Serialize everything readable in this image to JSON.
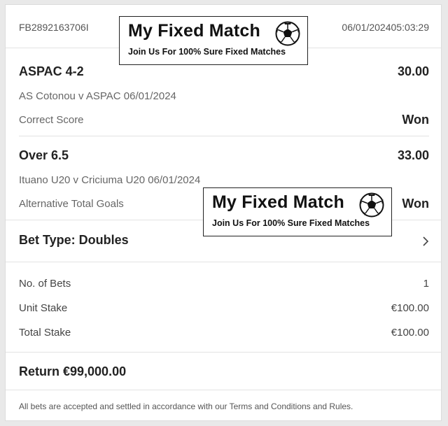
{
  "header": {
    "bet_id": "FB2892163706I",
    "datetime": "06/01/202405:03:29"
  },
  "watermark": {
    "title": "My Fixed Match",
    "subtitle": "Join Us For 100% Sure Fixed Matches",
    "icon": "soccer-ball-icon"
  },
  "selections": [
    {
      "title": "ASPAC 4-2",
      "odds": "30.00",
      "fixture": "AS Cotonou v ASPAC 06/01/2024",
      "market": "Correct Score",
      "result": "Won"
    },
    {
      "title": "Over 6.5",
      "odds": "33.00",
      "fixture": "Ituano U20 v Criciuma U20 06/01/2024",
      "market": "Alternative Total Goals",
      "result": "Won"
    }
  ],
  "bet_type": {
    "label": "Bet Type: Doubles",
    "icon": "chevron-right-icon"
  },
  "summary": [
    {
      "label": "No. of Bets",
      "value": "1"
    },
    {
      "label": "Unit Stake",
      "value": "€100.00"
    },
    {
      "label": "Total Stake",
      "value": "€100.00"
    }
  ],
  "return_text": "Return €99,000.00",
  "footer_note": "All bets are accepted and settled in accordance with our Terms and Conditions and Rules."
}
